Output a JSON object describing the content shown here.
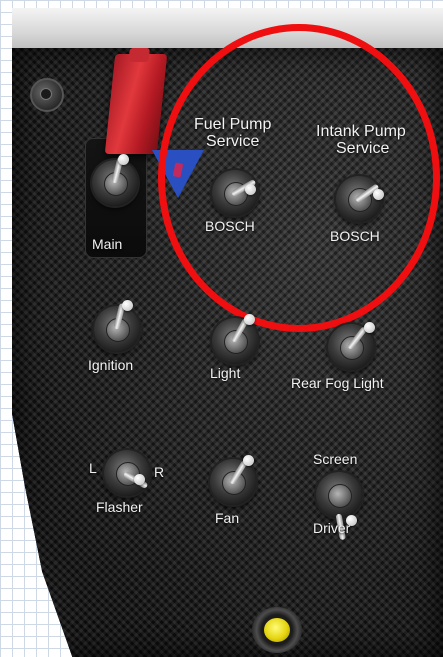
{
  "panel": {
    "highlight_color": "#ef0f10",
    "switches": [
      {
        "id": "main",
        "label": "Main"
      },
      {
        "id": "fuel-pump-service",
        "label_line1": "Fuel Pump",
        "label_line2": "Service",
        "brand": "BOSCH"
      },
      {
        "id": "intank-pump-service",
        "label_line1": "Intank Pump",
        "label_line2": "Service",
        "brand": "BOSCH"
      },
      {
        "id": "ignition",
        "label": "Ignition"
      },
      {
        "id": "light",
        "label": "Light"
      },
      {
        "id": "rear-fog-light",
        "label": "Rear Fog Light"
      },
      {
        "id": "flasher",
        "label": "Flasher",
        "left_label": "L",
        "right_label": "R"
      },
      {
        "id": "fan",
        "label": "Fan"
      },
      {
        "id": "wiper",
        "top_label": "Screen",
        "bottom_label": "Driver"
      }
    ]
  }
}
